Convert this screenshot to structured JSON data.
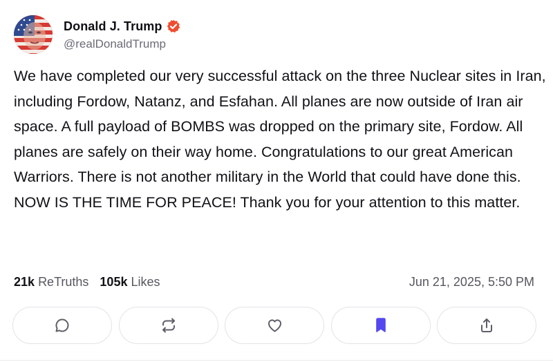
{
  "post": {
    "author": {
      "display_name": "Donald J. Trump",
      "handle": "@realDonaldTrump",
      "verified": true,
      "avatar_icon": "avatar-flag-portrait",
      "verified_color": "#ef4d2f"
    },
    "text": "We have completed our very successful attack on the three Nuclear sites in Iran, including Fordow, Natanz, and Esfahan. All planes are now outside of Iran air space. A full payload of BOMBS was dropped on the primary site, Fordow. All planes are safely on their way home. Congratulations to our great American Warriors. There is not another military in the World that could have done this. NOW IS THE TIME FOR PEACE! Thank you for your attention to this matter.",
    "stats": {
      "retruths_count": "21k",
      "retruths_label": "ReTruths",
      "likes_count": "105k",
      "likes_label": "Likes"
    },
    "timestamp": "Jun 21, 2025, 5:50 PM"
  },
  "actions": [
    {
      "name": "reply",
      "icon": "comment-bubble-icon"
    },
    {
      "name": "retruth",
      "icon": "repost-arrows-icon"
    },
    {
      "name": "like",
      "icon": "heart-icon"
    },
    {
      "name": "bookmark",
      "icon": "bookmark-icon",
      "active": true,
      "active_color": "#5448ee"
    },
    {
      "name": "share",
      "icon": "share-upload-icon"
    }
  ]
}
